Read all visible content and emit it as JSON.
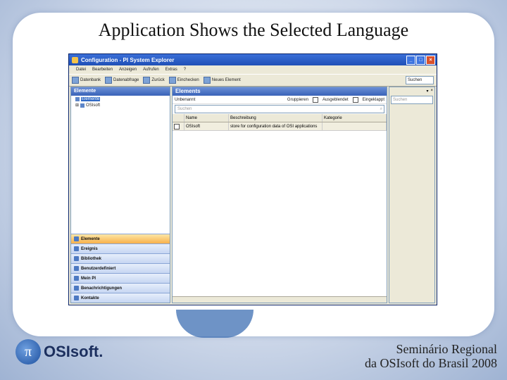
{
  "slide": {
    "title": "Application Shows the Selected Language",
    "footer_line1": "Seminário Regional",
    "footer_line2": "da OSIsoft do Brasil 2008",
    "logo_name": "OSIsoft."
  },
  "window": {
    "title": "Configuration - PI System Explorer",
    "menu": [
      "Datei",
      "Bearbeiten",
      "Anzeigen",
      "Aufrufen",
      "Extras",
      "?"
    ],
    "toolbar": [
      "Datenbank",
      "Datenabfrage",
      "Zurück",
      "Einchecken",
      "Neues Element"
    ],
    "search_label": "Suchen"
  },
  "left_pane": {
    "header": "Elemente",
    "tree": [
      "Elemente",
      "OSIsoft"
    ],
    "nav": [
      "Elemente",
      "Ereignis",
      "Bibliothek",
      "Benutzerdefiniert",
      "Mein PI",
      "Benachrichtigungen",
      "Kontakte"
    ]
  },
  "main_pane": {
    "header": "Elements",
    "row_label": "Unbenannt",
    "options": [
      "Gruppieren",
      "Ausgeblendet",
      "Eingeklappt"
    ],
    "filter_placeholder": "Suchen",
    "columns": [
      "",
      "Name",
      "Beschreibung",
      "Kategorie"
    ],
    "rows": [
      {
        "name": "OSIsoft",
        "description": "store for configuration data of OSI applications",
        "category": ""
      }
    ]
  },
  "right_pane": {
    "search_placeholder": "Suchen"
  }
}
